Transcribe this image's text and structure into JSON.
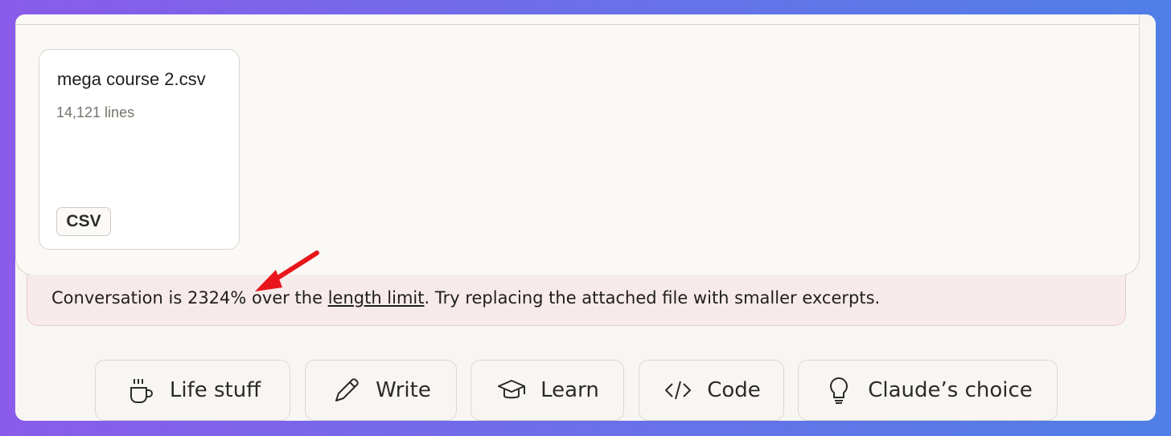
{
  "file": {
    "name": "mega course 2.csv",
    "lines": "14,121 lines",
    "type_badge": "CSV"
  },
  "alert": {
    "prefix": "Conversation is 2324% over the ",
    "link": "length limit",
    "suffix": ". Try replacing the attached file with smaller excerpts."
  },
  "chips": {
    "life": {
      "label": "Life stuff",
      "icon": "coffee-cup-icon"
    },
    "write": {
      "label": "Write",
      "icon": "pencil-icon"
    },
    "learn": {
      "label": "Learn",
      "icon": "graduation-cap-icon"
    },
    "code": {
      "label": "Code",
      "icon": "code-icon"
    },
    "choice": {
      "label": "Claude’s choice",
      "icon": "lightbulb-icon"
    }
  },
  "colors": {
    "alert_background": "#f6ebea",
    "annotation_arrow": "#e8161b",
    "gradient_start": "#8a5bea",
    "gradient_end": "#4f7fe6"
  }
}
